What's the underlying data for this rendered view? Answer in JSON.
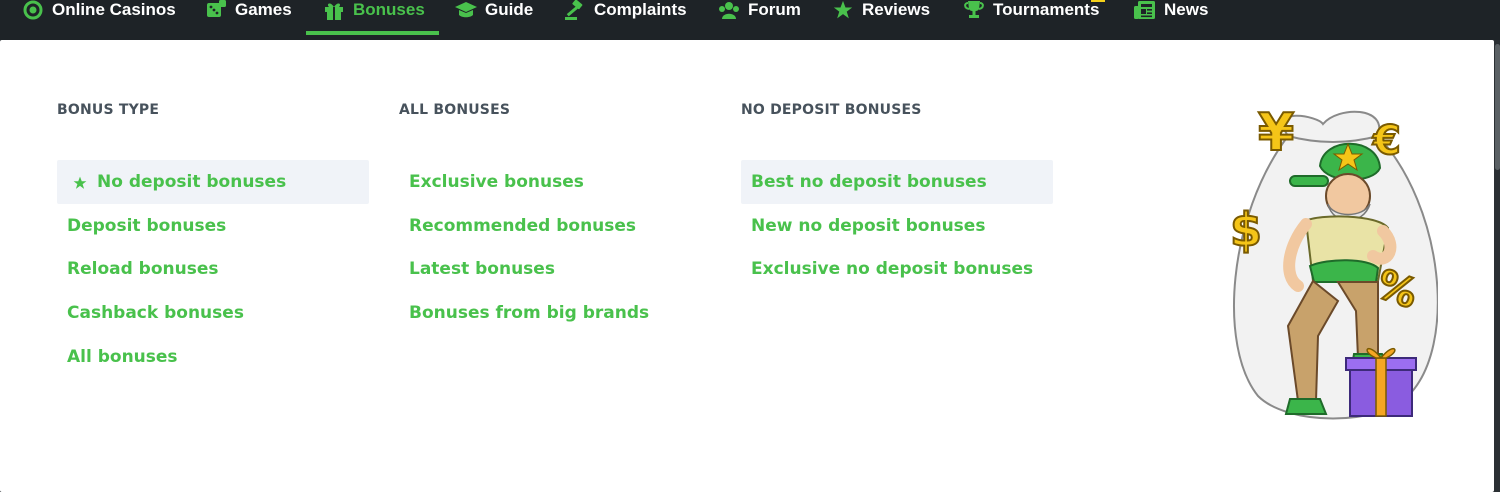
{
  "nav": {
    "items": [
      {
        "label": "Online Casinos",
        "icon": "chip-icon"
      },
      {
        "label": "Games",
        "icon": "dice-icon"
      },
      {
        "label": "Bonuses",
        "icon": "gift-icon",
        "active": true
      },
      {
        "label": "Guide",
        "icon": "graduation-cap-icon"
      },
      {
        "label": "Complaints",
        "icon": "gavel-icon"
      },
      {
        "label": "Forum",
        "icon": "users-icon"
      },
      {
        "label": "Reviews",
        "icon": "star-icon"
      },
      {
        "label": "Tournaments",
        "icon": "trophy-icon"
      },
      {
        "label": "News",
        "icon": "newspaper-icon"
      }
    ],
    "accent_color": "#49c14c"
  },
  "menu": {
    "bonus_type": {
      "title": "BONUS TYPE",
      "links": [
        "No deposit bonuses",
        "Deposit bonuses",
        "Reload bonuses",
        "Cashback bonuses",
        "All bonuses"
      ]
    },
    "all_bonuses": {
      "title": "ALL BONUSES",
      "links": [
        "Exclusive bonuses",
        "Recommended bonuses",
        "Latest bonuses",
        "Bonuses from big brands"
      ]
    },
    "no_deposit": {
      "title": "NO DEPOSIT BONUSES",
      "links": [
        "Best no deposit bonuses",
        "New no deposit bonuses",
        "Exclusive no deposit bonuses"
      ]
    }
  },
  "colors": {
    "link": "#49c14c",
    "highlight_bg": "#f0f3f8",
    "heading": "#47525c",
    "nav_bg": "#1e2327"
  }
}
